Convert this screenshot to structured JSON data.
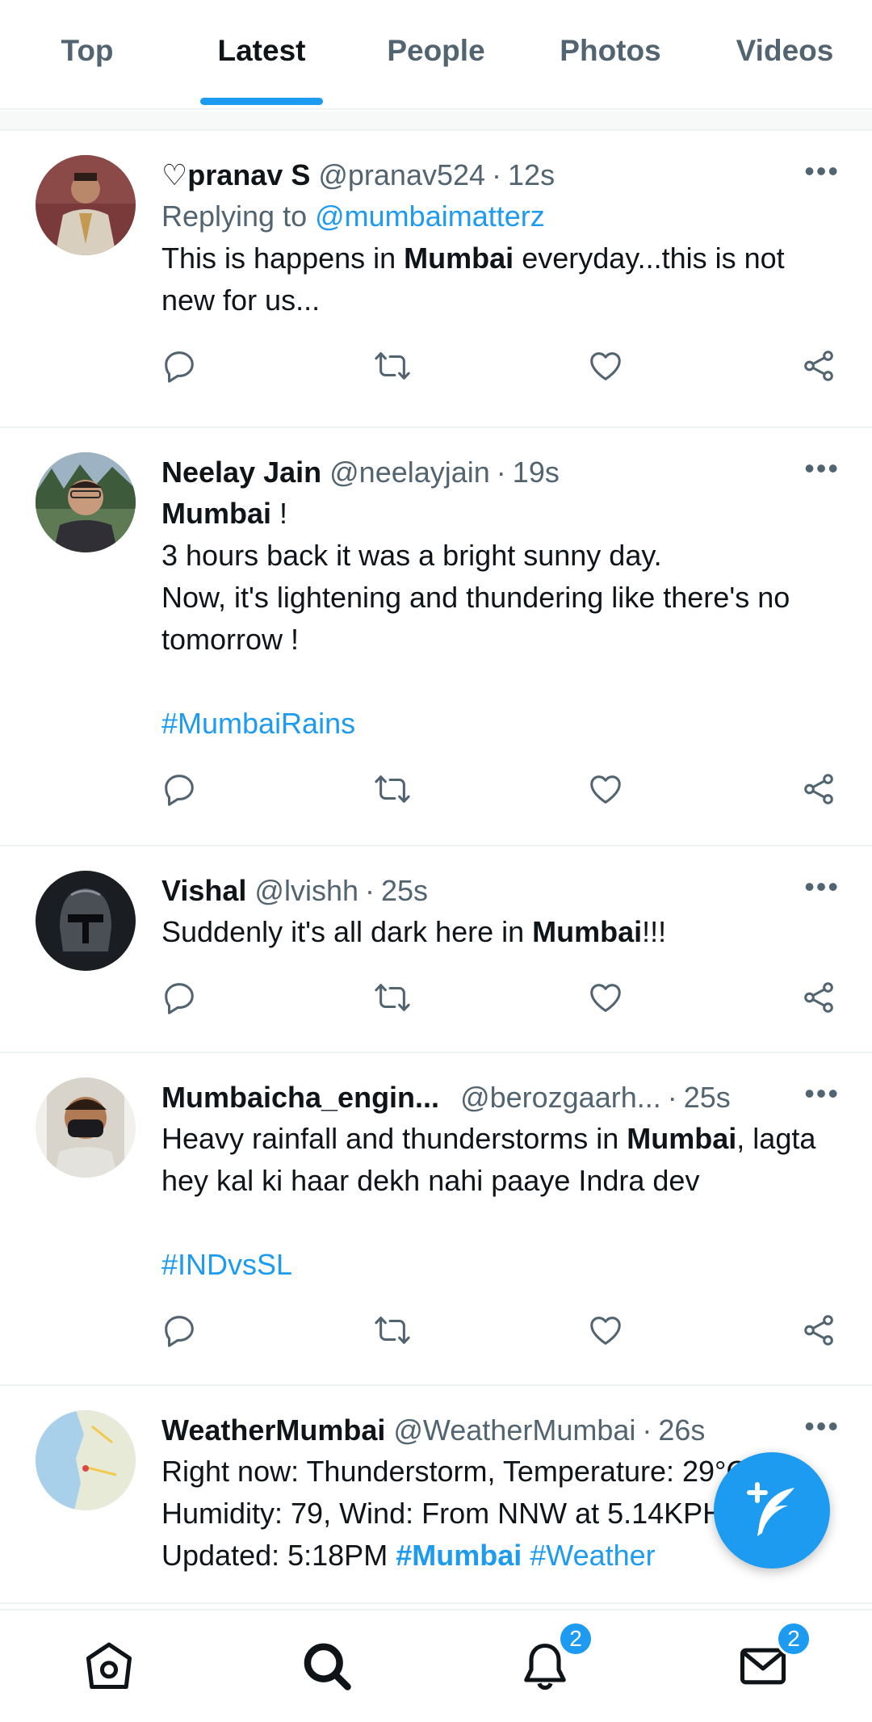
{
  "tabs": [
    {
      "label": "Top",
      "active": false
    },
    {
      "label": "Latest",
      "active": true
    },
    {
      "label": "People",
      "active": false
    },
    {
      "label": "Photos",
      "active": false
    },
    {
      "label": "Videos",
      "active": false
    }
  ],
  "accent_color": "#1d9bf0",
  "tweets": [
    {
      "name": "♡pranav S",
      "handle": "@pranav524",
      "time": "12s",
      "reply_prefix": "Replying to",
      "reply_to": "@mumbaimatterz",
      "text_parts": [
        "This is happens in ",
        "Mumbai",
        " everyday...this is not new for us..."
      ]
    },
    {
      "name": "Neelay Jain",
      "handle": "@neelayjain",
      "time": "19s",
      "line1_bold": "Mumbai",
      "line1_rest": " !",
      "line2": "3 hours back it was a bright sunny day.",
      "line3": "Now, it's lightening and thundering like there's no tomorrow !",
      "hashtag": "#MumbaiRains"
    },
    {
      "name": "Vishal",
      "handle": "@lvishh",
      "time": "25s",
      "text_parts": [
        "Suddenly it's all dark here in ",
        "Mumbai",
        "!!!"
      ]
    },
    {
      "name": "Mumbaicha_engin...",
      "handle": "@berozgaarh...",
      "time": "25s",
      "text_parts": [
        "Heavy rainfall and thunderstorms in ",
        "Mumbai",
        ", lagta hey kal ki haar dekh nahi paaye Indra dev"
      ],
      "hashtag": "#INDvsSL"
    },
    {
      "name": "WeatherMumbai",
      "handle": "@WeatherMumbai",
      "time": "26s",
      "line1": "Right now: Thunderstorm, Temperature: 29°C,",
      "line2": "Humidity: 79, Wind: From NNW at 5.14KPH",
      "line3_prefix": "Updated: 5:18PM ",
      "hashtag1": "#Mumbai",
      "hashtag2": "#Weather"
    }
  ],
  "more_label": "•••",
  "actions": [
    "reply-icon",
    "retweet-icon",
    "like-icon",
    "share-icon"
  ],
  "bottom_nav": {
    "items": [
      "home-icon",
      "search-icon",
      "notifications-icon",
      "messages-icon"
    ],
    "notifications_badge": "2",
    "messages_badge": "2"
  },
  "fab_icon": "compose-tweet-icon"
}
